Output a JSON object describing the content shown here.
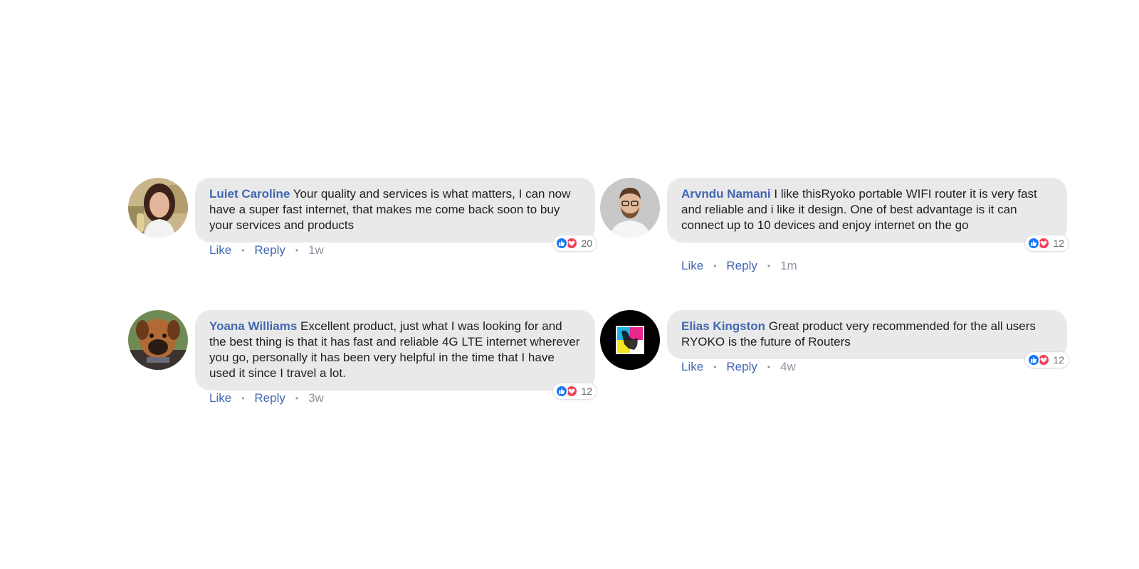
{
  "comments": [
    {
      "author": "Luiet Caroline",
      "text": "Your quality and services is what matters, I can now have a super fast internet, that makes me come back soon to buy your services and products",
      "reaction_count": "20",
      "like": "Like",
      "reply": "Reply",
      "time": "1w",
      "avatar": "woman-portrait"
    },
    {
      "author": "Arvndu Namani",
      "text": "I like thisRyoko portable WIFI router it is very fast and reliable and i like it design. One of best advantage is it can connect up to 10 devices and enjoy internet on the go",
      "reaction_count": "12",
      "like": "Like",
      "reply": "Reply",
      "time": "1m",
      "avatar": "man-portrait"
    },
    {
      "author": "Yoana Williams",
      "text": "Excellent product, just what I was looking for and the best thing is that it has fast and reliable 4G LTE internet wherever you go, personally it has been very helpful in the time that I have used it since I travel a lot.",
      "reaction_count": "12",
      "like": "Like",
      "reply": "Reply",
      "time": "3w",
      "avatar": "dog-portrait"
    },
    {
      "author": "Elias Kingston",
      "text": "Great product very recommended for the all users RYOKO is the future of Routers",
      "reaction_count": "12",
      "like": "Like",
      "reply": "Reply",
      "time": "4w",
      "avatar": "cmyk-logo"
    }
  ],
  "colors": {
    "author": "#4267b2",
    "bubble": "#e9e9e9",
    "like_reaction": "#1877f2",
    "love_reaction": "#f33e58"
  }
}
